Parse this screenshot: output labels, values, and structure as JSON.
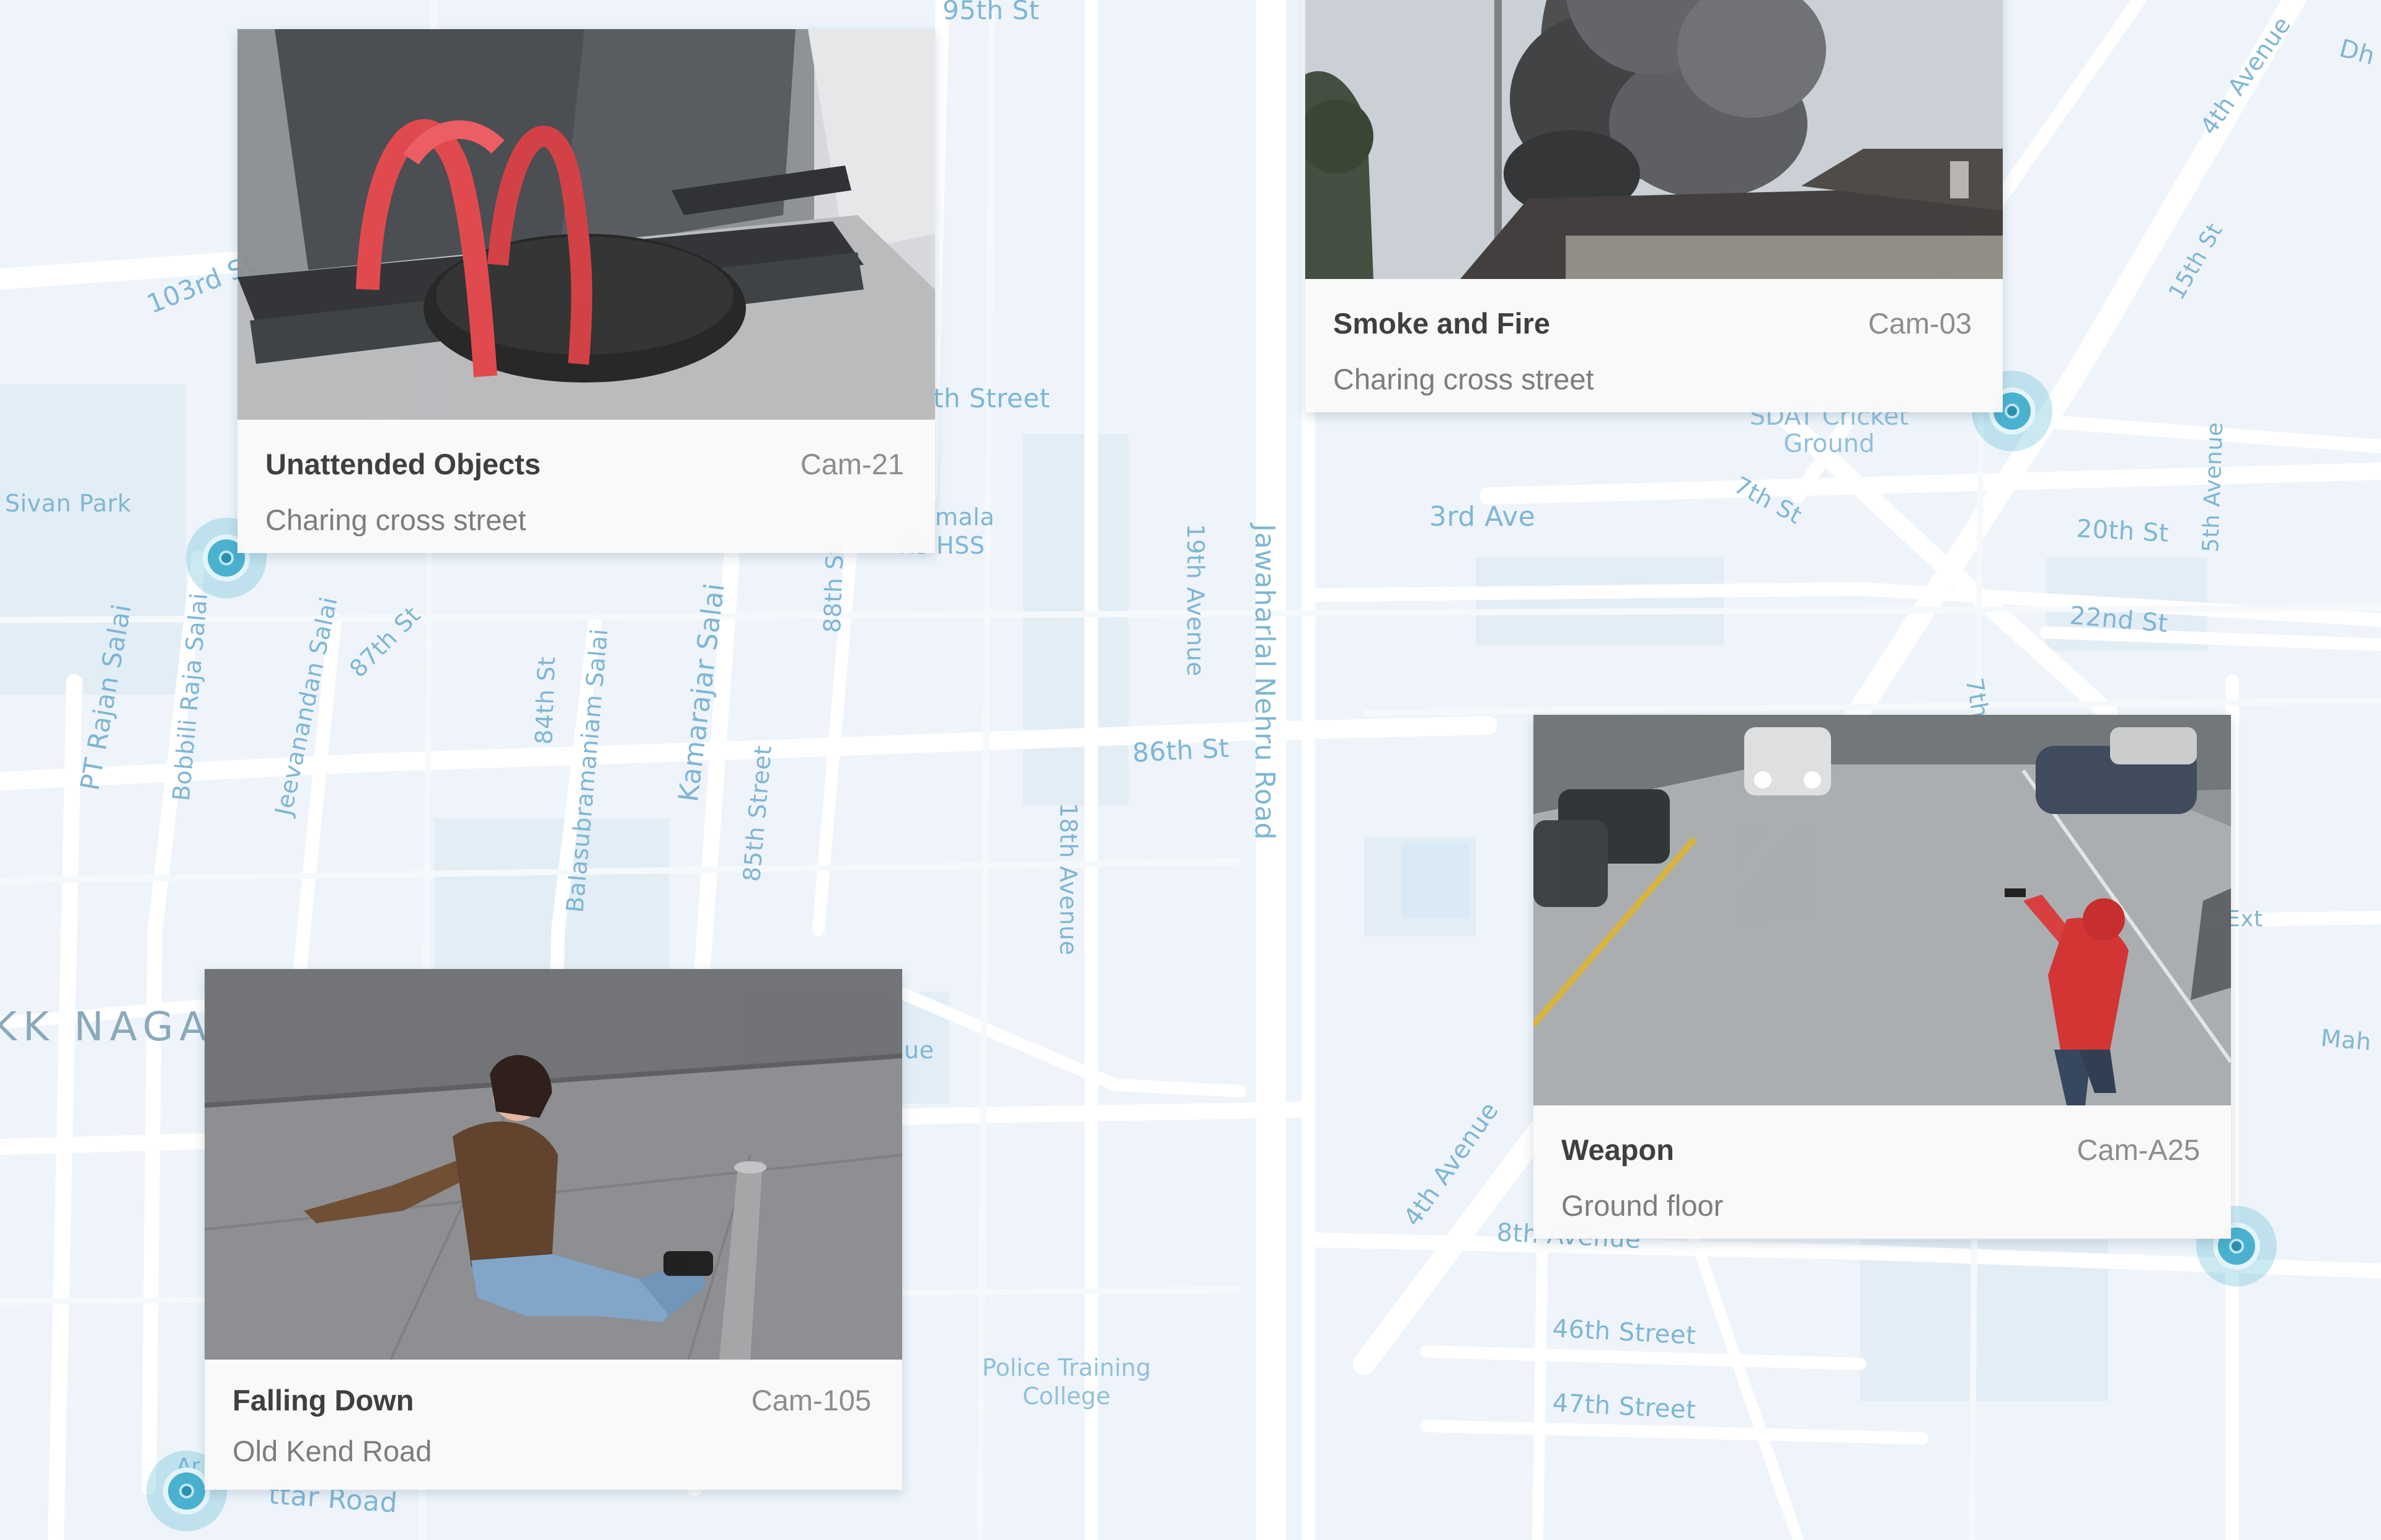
{
  "map": {
    "street_labels": [
      "95th St",
      "103rd St",
      "th Street",
      "Sivan Park",
      "mala",
      "ris HSS",
      "PT Rajan Salai",
      "Bobbili Raja Salai",
      "Jeevanandan Salai",
      "87th St",
      "84th St",
      "Balasubramaniam Salai",
      "Kamarajar Salai",
      "85th Street",
      "88th St",
      "19th Avenue",
      "Jawaharlal Nehru Road",
      "86th St",
      "18th Avenue",
      "3rd Ave",
      "SDAT Cricket",
      "Ground",
      "7th St",
      "4th Avenue",
      "15th St",
      "Dh",
      "20th St",
      "5th Avenue",
      "22nd St",
      "7th",
      "Ext",
      "Mah",
      "4th Avenue",
      "8th Avenue",
      "46th Street",
      "47th Street",
      "ue",
      "Police Training",
      "College",
      "Ar",
      "ttar Road"
    ],
    "area_name": "KK NAGA"
  },
  "alerts": [
    {
      "title": "Unattended Objects",
      "camera": "Cam-21",
      "location": "Charing cross street"
    },
    {
      "title": "Smoke and Fire",
      "camera": "Cam-03",
      "location": "Charing cross street"
    },
    {
      "title": "Weapon",
      "camera": "Cam-A25",
      "location": "Ground floor"
    },
    {
      "title": "Falling Down",
      "camera": "Cam-105",
      "location": "Old Kend Road"
    }
  ],
  "colors": {
    "map_bg": "#eef4fa",
    "road": "#ffffff",
    "pin": "#4ab2cf",
    "label": "#7fb6d3"
  }
}
